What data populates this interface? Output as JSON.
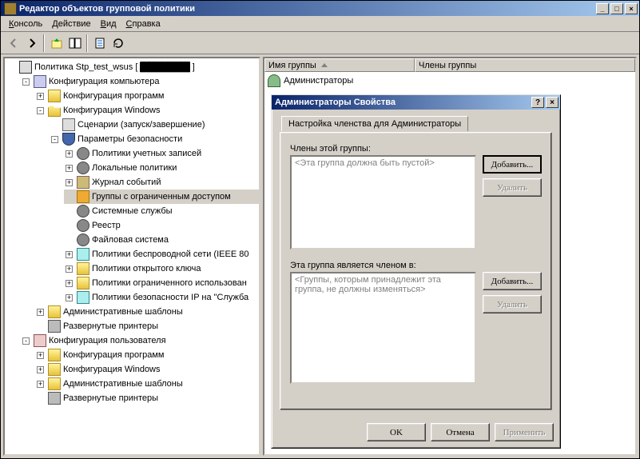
{
  "title": "Редактор объектов групповой политики",
  "menu": [
    "Консоль",
    "Действие",
    "Вид",
    "Справка"
  ],
  "tree": {
    "root": "Политика Stp_test_wsus [",
    "computer_config": "Конфигурация компьютера",
    "programs_config": "Конфигурация программ",
    "windows_config": "Конфигурация Windows",
    "scenarios": "Сценарии (запуск/завершение)",
    "security": "Параметры безопасности",
    "account_policies": "Политики учетных записей",
    "local_policies": "Локальные политики",
    "event_log": "Журнал событий",
    "restricted_groups": "Группы с ограниченным доступом",
    "system_services": "Системные службы",
    "registry": "Реестр",
    "filesystem": "Файловая система",
    "wireless": "Политики беспроводной сети (IEEE 80",
    "public_key": "Политики открытого ключа",
    "software_restriction": "Политики ограниченного использован",
    "ipsec": "Политики безопасности IP на \"Служба",
    "admin_templates": "Административные шаблоны",
    "deployed_printers": "Развернутые принтеры",
    "user_config": "Конфигурация пользователя",
    "programs_config2": "Конфигурация программ",
    "windows_config2": "Конфигурация Windows",
    "admin_templates2": "Административные шаблоны",
    "deployed_printers2": "Развернутые принтеры"
  },
  "list": {
    "col_group": "Имя группы",
    "col_members": "Члены группы",
    "row1": "Администраторы"
  },
  "dialog": {
    "title": "Администраторы Свойства",
    "tab": "Настройка членства для Администраторы",
    "members_label": "Члены этой группы:",
    "members_placeholder": "<Эта группа должна быть пустой>",
    "memberof_label": "Эта группа является членом в:",
    "memberof_placeholder": "<Группы, которым принадлежит эта группа, не должны изменяться>",
    "add": "Добавить...",
    "delete": "Удалить",
    "ok": "OK",
    "cancel": "Отмена",
    "apply": "Применить"
  }
}
